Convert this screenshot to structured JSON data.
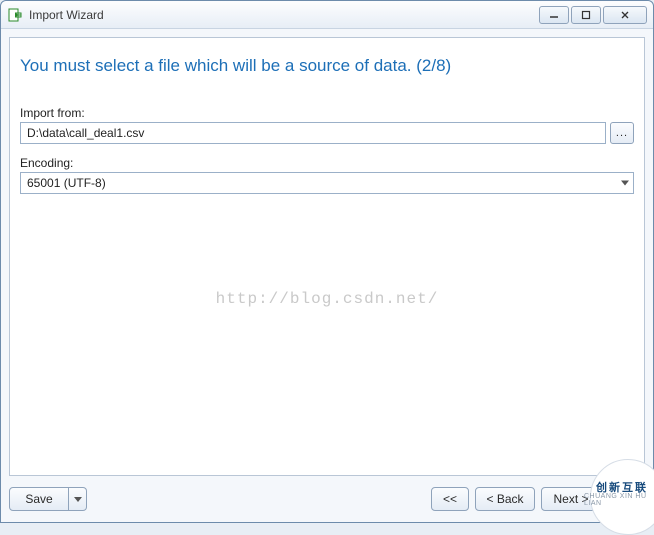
{
  "window": {
    "title": "Import Wizard"
  },
  "heading": "You must select a file which will be a source of data. (2/8)",
  "fields": {
    "import_from": {
      "label": "Import from:",
      "value": "D:\\data\\call_deal1.csv",
      "browse": "..."
    },
    "encoding": {
      "label": "Encoding:",
      "value": "65001 (UTF-8)"
    }
  },
  "watermark": "http://blog.csdn.net/",
  "buttons": {
    "save": "Save",
    "first": "<<",
    "back": "< Back",
    "next": "Next >",
    "last": ">>"
  },
  "badge": {
    "line1": "创新互联",
    "line2": "CHUANG XIN HU LIAN"
  }
}
